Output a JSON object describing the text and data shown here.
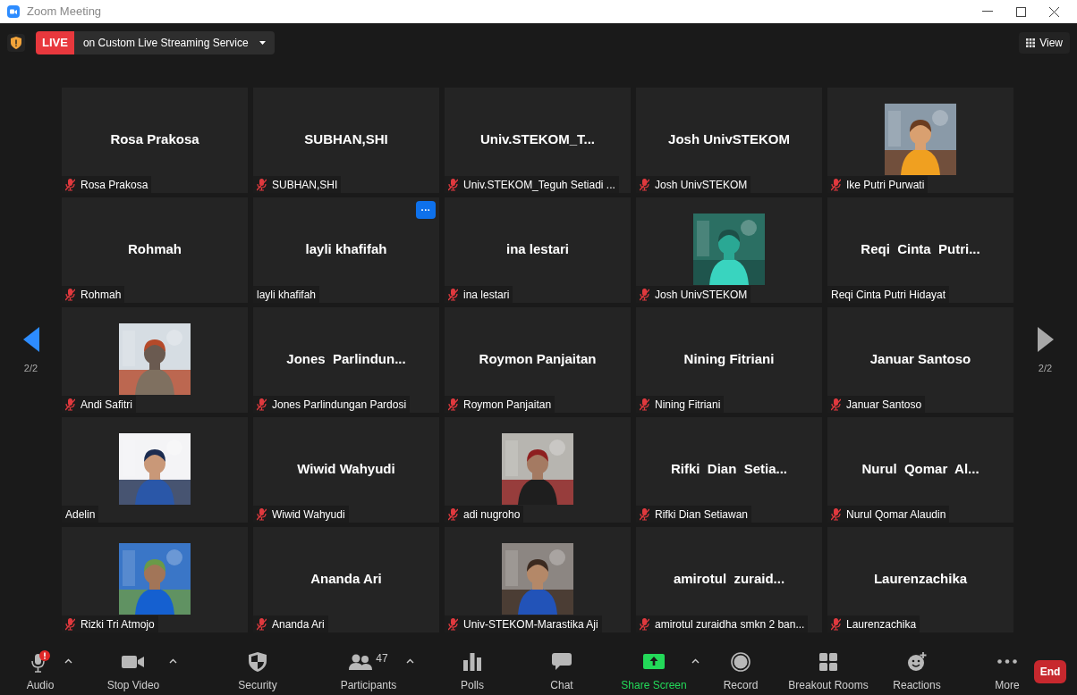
{
  "window": {
    "title": "Zoom Meeting"
  },
  "live": {
    "badge": "LIVE",
    "service": "on Custom Live Streaming Service"
  },
  "view_button": "View",
  "pager": {
    "left": "2/2",
    "right": "2/2"
  },
  "tiles": [
    {
      "kind": "name",
      "display_name": "Rosa Prakosa",
      "label": "Rosa Prakosa",
      "muted": true
    },
    {
      "kind": "name",
      "display_name": "SUBHAN,SHI",
      "label": "SUBHAN,SHI",
      "muted": true
    },
    {
      "kind": "name",
      "display_name": "Univ.STEKOM_T...",
      "label": "Univ.STEKOM_Teguh Setiadi ...",
      "muted": true
    },
    {
      "kind": "name",
      "display_name": "Josh UnivSTEKOM",
      "label": "Josh UnivSTEKOM",
      "muted": true
    },
    {
      "kind": "picture",
      "label": "Ike Putri Purwati",
      "muted": true
    },
    {
      "kind": "name",
      "display_name": "Rohmah",
      "label": "Rohmah",
      "muted": true
    },
    {
      "kind": "name",
      "display_name": "layli khafifah",
      "label": "layli khafifah",
      "muted": false,
      "menu": "···"
    },
    {
      "kind": "name",
      "display_name": "ina lestari",
      "label": "ina lestari",
      "muted": true
    },
    {
      "kind": "picture",
      "label": "Josh UnivSTEKOM",
      "muted": true
    },
    {
      "kind": "name",
      "display_name": "Reqi  Cinta  Putri...",
      "label": "Reqi Cinta Putri Hidayat",
      "muted": false
    },
    {
      "kind": "picture",
      "label": "Andi Safitri",
      "muted": true
    },
    {
      "kind": "name",
      "display_name": "Jones  Parlindun...",
      "label": "Jones Parlindungan Pardosi",
      "muted": true
    },
    {
      "kind": "name",
      "display_name": "Roymon Panjaitan",
      "label": "Roymon Panjaitan",
      "muted": true
    },
    {
      "kind": "name",
      "display_name": "Nining Fitriani",
      "label": "Nining Fitriani",
      "muted": true
    },
    {
      "kind": "name",
      "display_name": "Januar Santoso",
      "label": "Januar Santoso",
      "muted": true
    },
    {
      "kind": "picture",
      "label": "Adelin",
      "muted": false
    },
    {
      "kind": "name",
      "display_name": "Wiwid Wahyudi",
      "label": "Wiwid Wahyudi",
      "muted": true
    },
    {
      "kind": "picture",
      "label": "adi nugroho",
      "muted": true
    },
    {
      "kind": "name",
      "display_name": "Rifki  Dian  Setia...",
      "label": "Rifki Dian Setiawan",
      "muted": true
    },
    {
      "kind": "name",
      "display_name": "Nurul  Qomar  Al...",
      "label": "Nurul Qomar Alaudin",
      "muted": true
    },
    {
      "kind": "picture",
      "label": "Rizki Tri Atmojo",
      "muted": true
    },
    {
      "kind": "name",
      "display_name": "Ananda Ari",
      "label": "Ananda Ari",
      "muted": true
    },
    {
      "kind": "picture",
      "label": "Univ-STEKOM-Marastika Aji",
      "muted": true
    },
    {
      "kind": "name",
      "display_name": "amirotul  zuraid...",
      "label": "amirotul zuraidha smkn 2 ban...",
      "muted": true
    },
    {
      "kind": "name",
      "display_name": "Laurenzachika",
      "label": "Laurenzachika",
      "muted": true
    }
  ],
  "toolbar": [
    {
      "label": "Audio",
      "caret": true
    },
    {
      "label": "Stop Video",
      "caret": true
    },
    {
      "label": "Security",
      "caret": false
    },
    {
      "label": "Participants",
      "caret": true,
      "count": "47"
    },
    {
      "label": "Polls",
      "caret": false
    },
    {
      "label": "Chat",
      "caret": false
    },
    {
      "label": "Share Screen",
      "caret": true
    },
    {
      "label": "Record",
      "caret": false
    },
    {
      "label": "Breakout Rooms",
      "caret": false
    },
    {
      "label": "Reactions",
      "caret": false
    },
    {
      "label": "More",
      "caret": false
    }
  ],
  "end_button": "End"
}
